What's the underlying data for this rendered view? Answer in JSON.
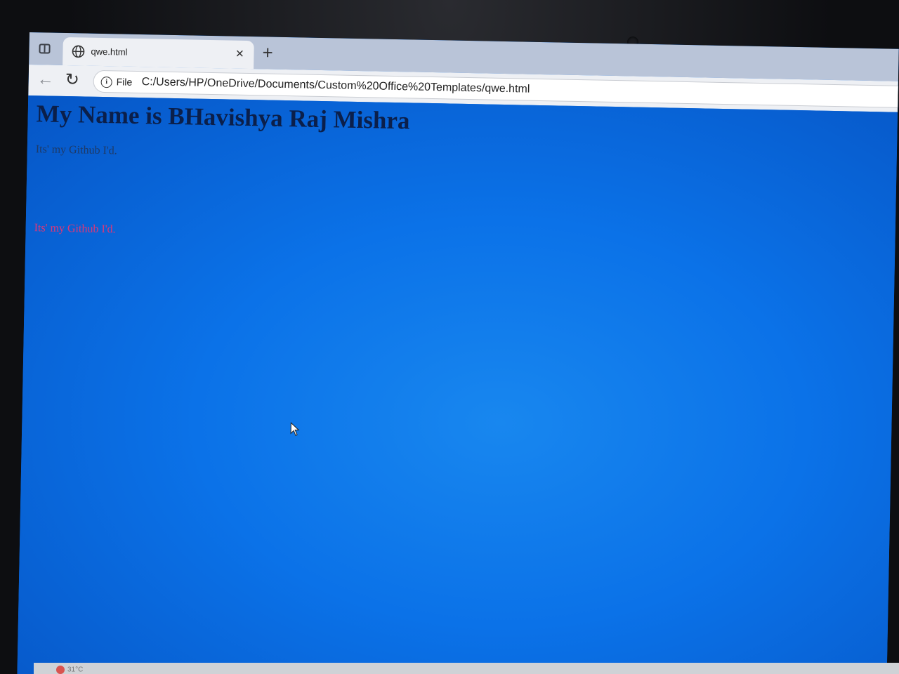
{
  "browser": {
    "tab": {
      "title": "qwe.html",
      "close_label": "×"
    },
    "new_tab_label": "+",
    "nav": {
      "back_label": "←",
      "reload_label": "↻"
    },
    "address_bar": {
      "info_glyph": "i",
      "scheme_label": "File",
      "url": "C:/Users/HP/OneDrive/Documents/Custom%20Office%20Templates/qwe.html"
    }
  },
  "page": {
    "heading": "My Name is BHavishya Raj Mishra",
    "paragraphs": [
      "Its' my Github I'd.",
      "Its' my Github I'd."
    ],
    "colors": {
      "background": "#0a6ee8",
      "heading": "#0b1f4a",
      "paragraph_1": "#1f3a66",
      "paragraph_2": "#e03777"
    }
  },
  "taskbar": {
    "weather_text": "31°C"
  }
}
